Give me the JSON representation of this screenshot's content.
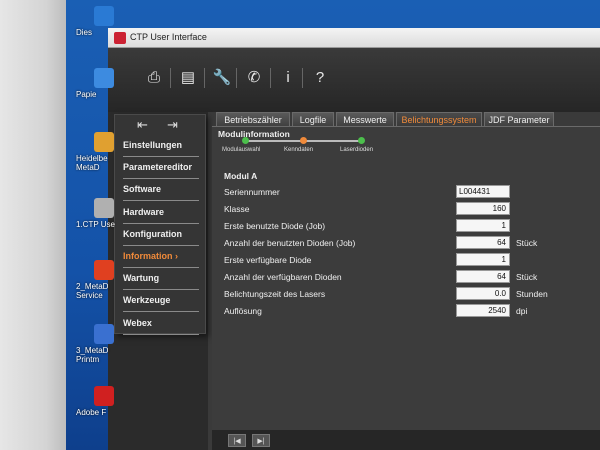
{
  "desktop": {
    "icons": [
      {
        "label": "Dies",
        "color": "#2a7ad4"
      },
      {
        "label": "Papie",
        "color": "#3d8be0"
      },
      {
        "label": "Heidelbe\nMetaD",
        "color": "#e0a030"
      },
      {
        "label": "1.CTP Use",
        "color": "#b0b0b0"
      },
      {
        "label": "2_MetaD\nService",
        "color": "#e04020"
      },
      {
        "label": "3_MetaD\nPrintm",
        "color": "#3a70d0"
      },
      {
        "label": "Adobe F",
        "color": "#d02020"
      }
    ]
  },
  "window": {
    "title": "CTP User Interface"
  },
  "toolbar": {
    "items": [
      {
        "icon": "clipboard-icon",
        "glyph": "⎙"
      },
      {
        "icon": "abc-document-icon",
        "glyph": "▤"
      },
      {
        "icon": "wrench-icon",
        "glyph": "🔧",
        "active": true,
        "color": "#f08a3a"
      },
      {
        "icon": "phone-icon",
        "glyph": "✆"
      },
      {
        "icon": "info-icon",
        "glyph": "i"
      },
      {
        "icon": "help-icon",
        "glyph": "?"
      }
    ]
  },
  "menu": {
    "items": [
      {
        "label": "Einstellungen"
      },
      {
        "label": "Parametereditor"
      },
      {
        "label": "Software"
      },
      {
        "label": "Hardware"
      },
      {
        "label": "Konfiguration"
      },
      {
        "label": "Information",
        "active": true
      },
      {
        "label": "Wartung"
      },
      {
        "label": "Werkzeuge"
      },
      {
        "label": "Webex"
      }
    ]
  },
  "tabs": [
    {
      "label": "Betriebszähler"
    },
    {
      "label": "Logfile"
    },
    {
      "label": "Messwerte"
    },
    {
      "label": "Belichtungssystem",
      "active": true
    },
    {
      "label": "JDF Parameter"
    }
  ],
  "panel": {
    "section_title": "Modulinformation",
    "steps": [
      {
        "label": "Modulauswahl",
        "color": "#4cbf4c"
      },
      {
        "label": "Kenndaten",
        "color": "#f08a3a"
      },
      {
        "label": "Laserdioden",
        "color": "#4cbf4c"
      }
    ],
    "module_title": "Modul A",
    "rows": [
      {
        "label": "Seriennummer",
        "value": "L004431",
        "unit": ""
      },
      {
        "label": "Klasse",
        "value": "160",
        "unit": ""
      },
      {
        "label": "Erste benutzte Diode (Job)",
        "value": "1",
        "unit": ""
      },
      {
        "label": "Anzahl der benutzten Dioden (Job)",
        "value": "64",
        "unit": "Stück"
      },
      {
        "label": "Erste verfügbare Diode",
        "value": "1",
        "unit": ""
      },
      {
        "label": "Anzahl der verfügbaren Dioden",
        "value": "64",
        "unit": "Stück"
      },
      {
        "label": "Belichtungszeit des Lasers",
        "value": "0.0",
        "unit": "Stunden"
      },
      {
        "label": "Auflösung",
        "value": "2540",
        "unit": "dpi"
      }
    ]
  }
}
